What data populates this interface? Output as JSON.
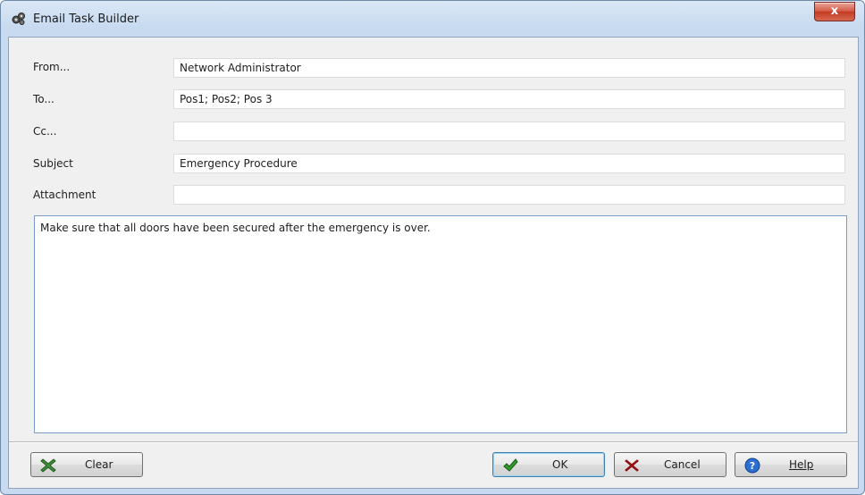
{
  "window": {
    "title": "Email Task Builder",
    "close_symbol": "x",
    "icon": "gears-icon"
  },
  "form": {
    "from": {
      "label": "From...",
      "value": "Network Administrator"
    },
    "to": {
      "label": "To...",
      "value": "Pos1; Pos2; Pos 3"
    },
    "cc": {
      "label": "Cc...",
      "value": ""
    },
    "subject": {
      "label": "Subject",
      "value": "Emergency Procedure"
    },
    "attachment": {
      "label": "Attachment",
      "value": ""
    },
    "body": "Make sure that all doors have been secured after the emergency is over."
  },
  "buttons": {
    "clear": {
      "label": "Clear",
      "icon": "green-x-icon"
    },
    "ok": {
      "label": "OK",
      "icon": "green-check-icon"
    },
    "cancel": {
      "label": "Cancel",
      "icon": "red-x-icon"
    },
    "help": {
      "label": "Help",
      "icon": "help-question-icon"
    }
  },
  "colors": {
    "title_bar": "#c7daf0",
    "close_button": "#c33b24",
    "field_focus_border": "#7a9cc6"
  }
}
